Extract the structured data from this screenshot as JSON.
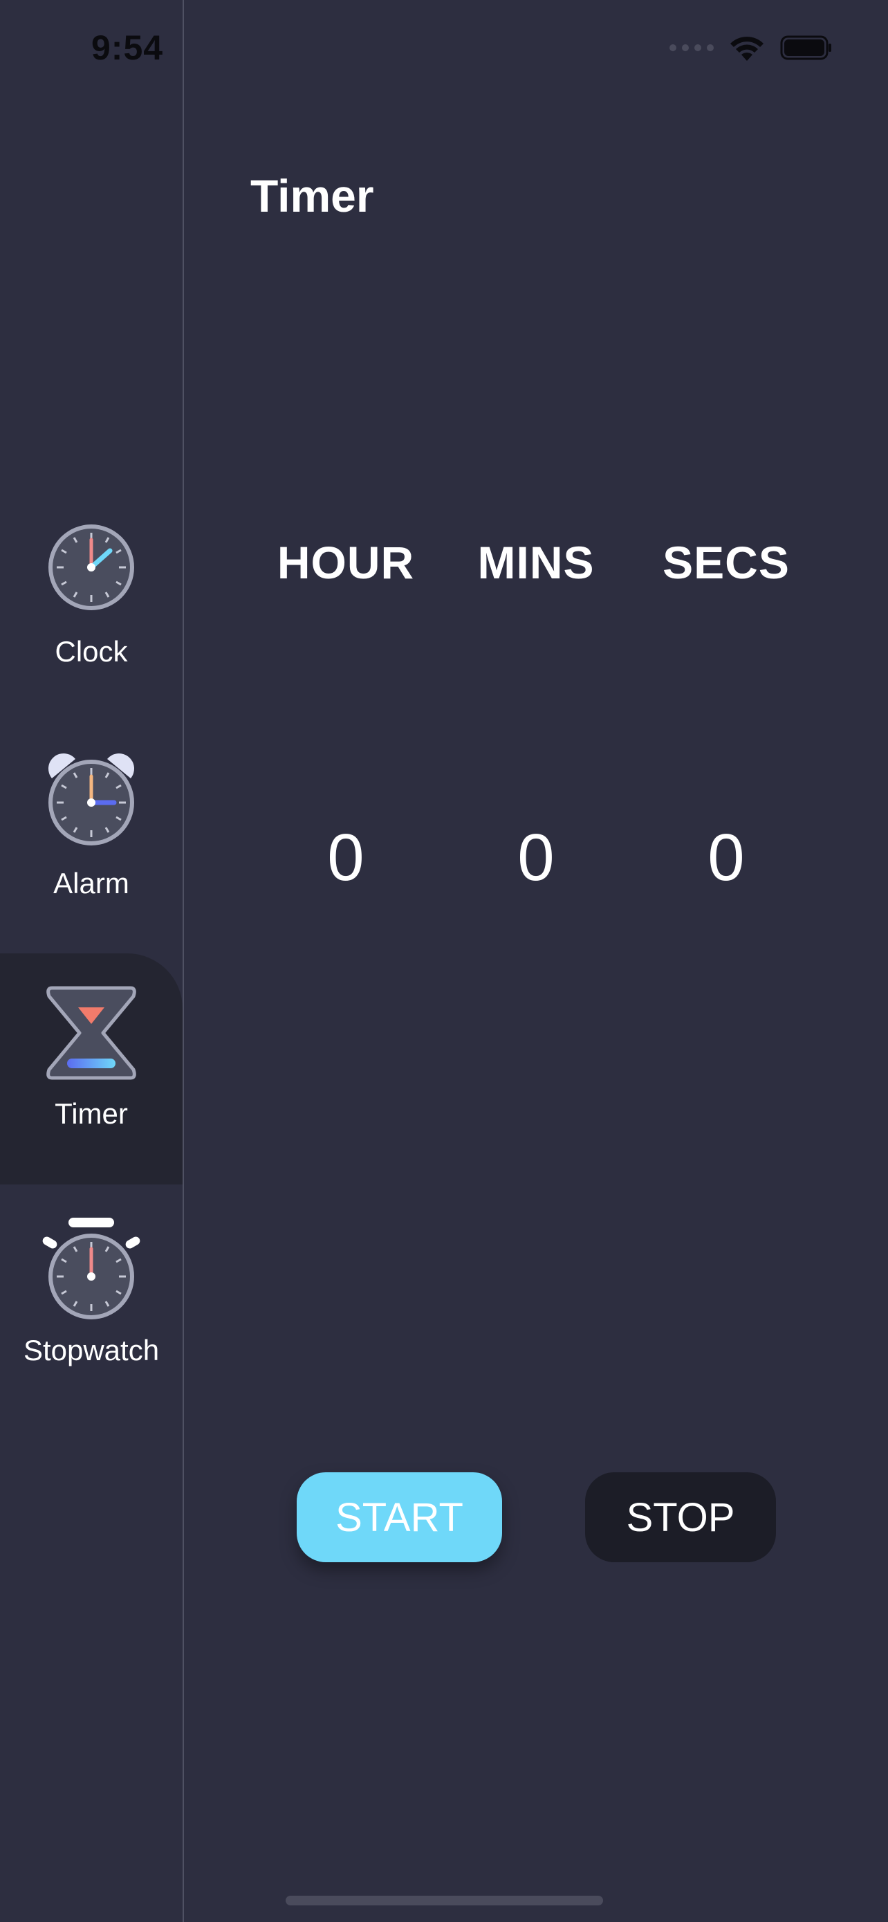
{
  "status_bar": {
    "time": "9:54"
  },
  "sidebar": {
    "items": [
      {
        "label": "Clock",
        "icon": "clock-icon"
      },
      {
        "label": "Alarm",
        "icon": "alarm-icon"
      },
      {
        "label": "Timer",
        "icon": "timer-icon",
        "active": true
      },
      {
        "label": "Stopwatch",
        "icon": "stopwatch-icon"
      }
    ]
  },
  "main": {
    "title": "Timer",
    "columns": [
      {
        "label": "HOUR",
        "value": "0"
      },
      {
        "label": "MINS",
        "value": "0"
      },
      {
        "label": "SECS",
        "value": "0"
      }
    ],
    "start_label": "START",
    "stop_label": "STOP"
  },
  "colors": {
    "background": "#2d2e40",
    "sidebar_active": "#242531",
    "start_button": "#6fd8f9",
    "stop_button": "#1c1d27"
  }
}
